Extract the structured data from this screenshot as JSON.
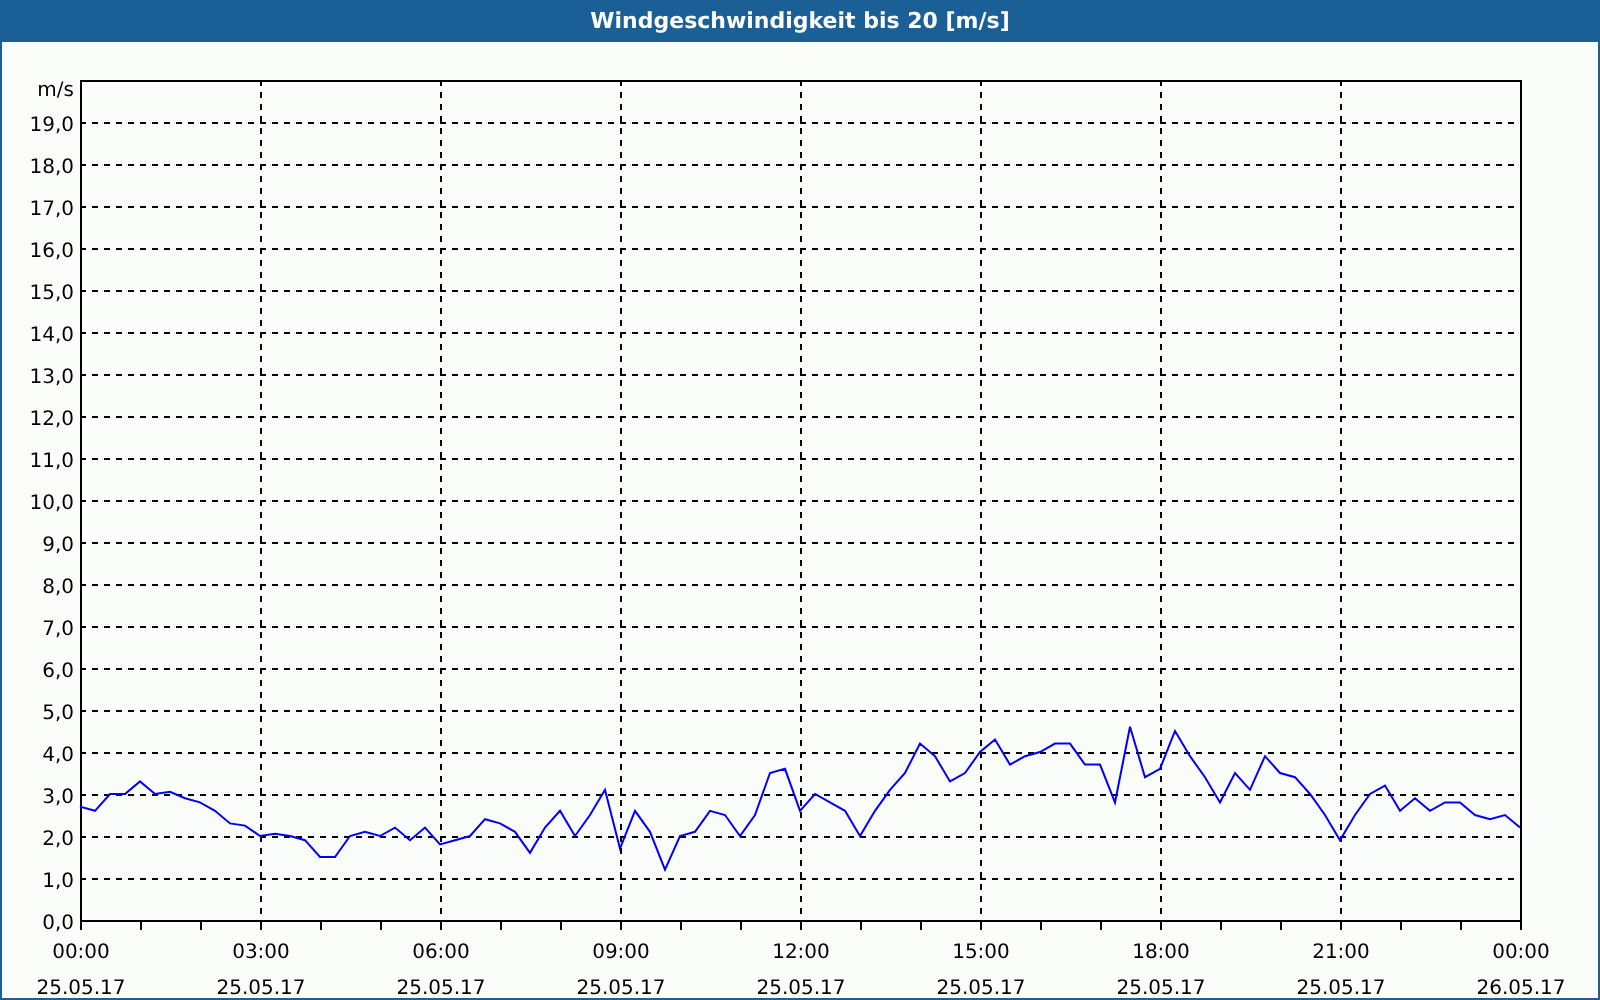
{
  "window": {
    "title": "Windgeschwindigkeit bis 20 [m/s]"
  },
  "chart": {
    "chart_data": {
      "type": "line",
      "grid": true,
      "ylabel": "m/s",
      "categories": [
        "00:00\n25.05.17",
        null,
        null,
        null,
        null,
        null,
        null,
        null,
        null,
        null,
        null,
        null,
        "03:00\n25.05.17",
        null,
        null,
        null,
        null,
        null,
        null,
        null,
        null,
        null,
        null,
        null,
        "06:00\n25.05.17",
        null,
        null,
        null,
        null,
        null,
        null,
        null,
        null,
        null,
        null,
        null,
        "09:00\n25.05.17",
        null,
        null,
        null,
        null,
        null,
        null,
        null,
        null,
        null,
        null,
        null,
        "12:00\n25.05.17",
        null,
        null,
        null,
        null,
        null,
        null,
        null,
        null,
        null,
        null,
        null,
        "15:00\n25.05.17",
        null,
        null,
        null,
        null,
        null,
        null,
        null,
        null,
        null,
        null,
        null,
        "18:00\n25.05.17",
        null,
        null,
        null,
        null,
        null,
        null,
        null,
        null,
        null,
        null,
        null,
        "21:00\n25.05.17",
        null,
        null,
        null,
        null,
        null,
        null,
        null,
        null,
        null,
        null,
        null,
        "00:00\n26.05.17"
      ],
      "series": [
        {
          "color": "#0000ff",
          "values": [
            2.7,
            2.6,
            3.0,
            3.0,
            3.3,
            3.0,
            3.05,
            2.9,
            2.8,
            2.6,
            2.3,
            2.25,
            2.0,
            2.05,
            2.0,
            1.9,
            1.5,
            1.5,
            2.0,
            2.1,
            2.0,
            2.2,
            1.9,
            2.2,
            1.8,
            1.9,
            2.0,
            2.4,
            2.3,
            2.1,
            1.6,
            2.2,
            2.6,
            2.0,
            2.5,
            3.1,
            1.7,
            2.6,
            2.1,
            1.2,
            2.0,
            2.1,
            2.6,
            2.5,
            2.0,
            2.5,
            3.5,
            3.6,
            2.6,
            3.0,
            2.8,
            2.6,
            2.0,
            2.6,
            3.1,
            3.5,
            4.2,
            3.9,
            3.3,
            3.5,
            4.0,
            4.3,
            3.7,
            3.9,
            4.0,
            4.2,
            4.2,
            3.7,
            3.7,
            2.8,
            4.6,
            3.4,
            3.6,
            4.5,
            3.9,
            3.4,
            2.8,
            3.5,
            3.1,
            3.9,
            3.5,
            3.4,
            3.0,
            2.5,
            1.9,
            2.5,
            3.0,
            3.2,
            2.6,
            2.9,
            2.6,
            2.8,
            2.8,
            2.5,
            2.4,
            2.5,
            2.2
          ]
        }
      ],
      "ylim": [
        0,
        20
      ],
      "yticks": [
        {
          "value": 0,
          "label": "0,0"
        },
        {
          "value": 1,
          "label": "1,0"
        },
        {
          "value": 2,
          "label": "2,0"
        },
        {
          "value": 3,
          "label": "3,0"
        },
        {
          "value": 4,
          "label": "4,0"
        },
        {
          "value": 5,
          "label": "5,0"
        },
        {
          "value": 6,
          "label": "6,0"
        },
        {
          "value": 7,
          "label": "7,0"
        },
        {
          "value": 8,
          "label": "8,0"
        },
        {
          "value": 9,
          "label": "9,0"
        },
        {
          "value": 10,
          "label": "10,0"
        },
        {
          "value": 11,
          "label": "11,0"
        },
        {
          "value": 12,
          "label": "12,0"
        },
        {
          "value": 13,
          "label": "13,0"
        },
        {
          "value": 14,
          "label": "14,0"
        },
        {
          "value": 15,
          "label": "15,0"
        },
        {
          "value": 16,
          "label": "16,0"
        },
        {
          "value": 17,
          "label": "17,0"
        },
        {
          "value": 18,
          "label": "18,0"
        },
        {
          "value": 19,
          "label": "19,0"
        }
      ]
    }
  }
}
